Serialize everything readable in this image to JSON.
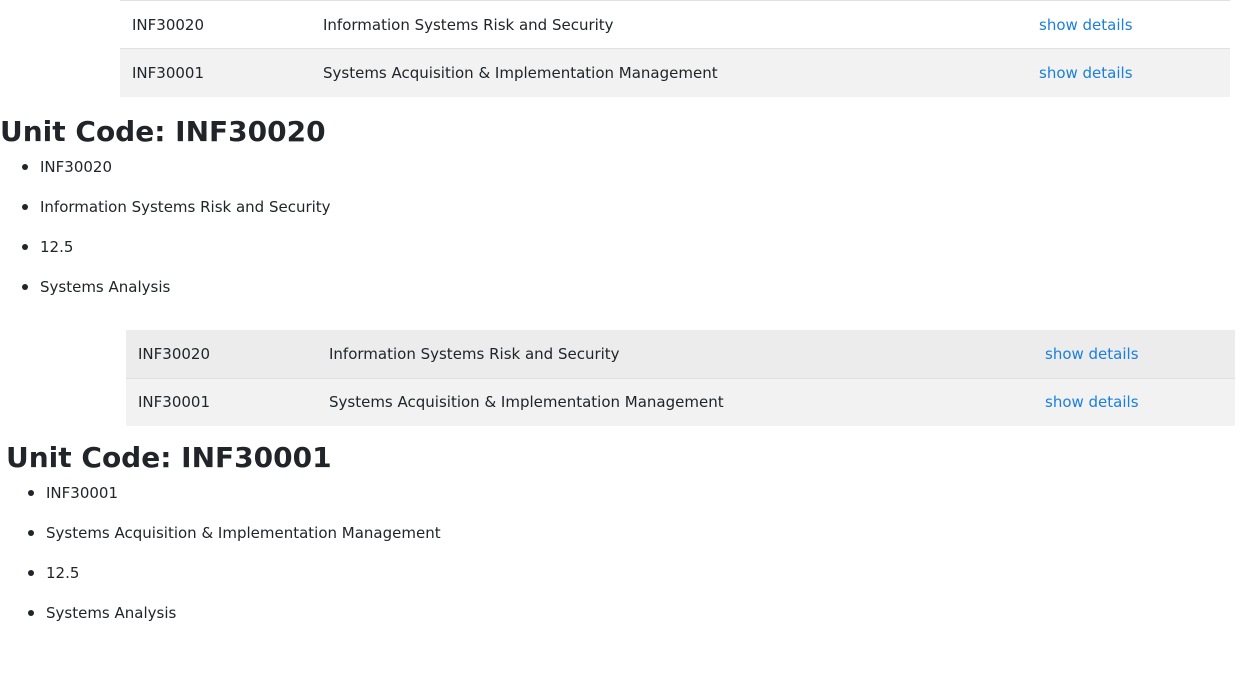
{
  "units": [
    {
      "code": "INF30020",
      "name": "Information Systems Risk and Security",
      "action": "show details"
    },
    {
      "code": "INF30001",
      "name": "Systems Acquisition & Implementation Management",
      "action": "show details"
    }
  ],
  "details": [
    {
      "heading": "Unit Code: INF30020",
      "items": [
        "INF30020",
        "Information Systems Risk and Security",
        "12.5",
        "Systems Analysis"
      ]
    },
    {
      "heading": "Unit Code: INF30001",
      "items": [
        "INF30001",
        "Systems Acquisition & Implementation Management",
        "12.5",
        "Systems Analysis"
      ]
    }
  ]
}
